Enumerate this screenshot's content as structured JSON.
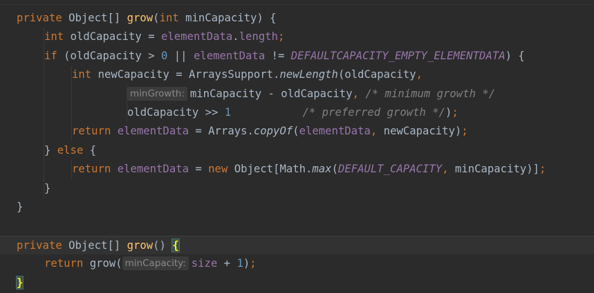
{
  "editor": {
    "lines": [
      {
        "indent": 0,
        "tokens": [
          {
            "t": "private ",
            "c": "kw"
          },
          {
            "t": "Object[] ",
            "c": "plain"
          },
          {
            "t": "grow",
            "c": "fn"
          },
          {
            "t": "(",
            "c": "plain"
          },
          {
            "t": "int ",
            "c": "kw"
          },
          {
            "t": "minCapacity) {",
            "c": "plain"
          }
        ]
      },
      {
        "indent": 1,
        "tokens": [
          {
            "t": "int ",
            "c": "kw"
          },
          {
            "t": "oldCapacity = ",
            "c": "plain"
          },
          {
            "t": "elementData",
            "c": "field"
          },
          {
            "t": ".",
            "c": "plain"
          },
          {
            "t": "length",
            "c": "field"
          },
          {
            "t": ";",
            "c": "kw"
          }
        ]
      },
      {
        "indent": 1,
        "tokens": [
          {
            "t": "if ",
            "c": "kw"
          },
          {
            "t": "(oldCapacity > ",
            "c": "plain"
          },
          {
            "t": "0",
            "c": "num"
          },
          {
            "t": " || ",
            "c": "plain"
          },
          {
            "t": "elementData",
            "c": "field"
          },
          {
            "t": " != ",
            "c": "plain"
          },
          {
            "t": "DEFAULTCAPACITY_EMPTY_ELEMENTDATA",
            "c": "const"
          },
          {
            "t": ") {",
            "c": "plain"
          }
        ]
      },
      {
        "indent": 2,
        "tokens": [
          {
            "t": "int ",
            "c": "kw"
          },
          {
            "t": "newCapacity = ArraysSupport.",
            "c": "plain"
          },
          {
            "t": "newLength",
            "c": "static"
          },
          {
            "t": "(oldCapacity",
            "c": "plain"
          },
          {
            "t": ",",
            "c": "kw"
          }
        ]
      },
      {
        "indent": 4,
        "hint": "minGrowth:",
        "tokens": [
          {
            "t": "minCapacity - oldCapacity",
            "c": "plain"
          },
          {
            "t": ", ",
            "c": "kw"
          },
          {
            "t": "/* minimum growth */",
            "c": "cmt"
          }
        ]
      },
      {
        "indent": 4,
        "tokens": [
          {
            "t": "oldCapacity >> ",
            "c": "plain"
          },
          {
            "t": "1",
            "c": "num"
          },
          {
            "t": "           ",
            "c": "plain"
          },
          {
            "t": "/* preferred growth */",
            "c": "cmt"
          },
          {
            "t": ")",
            "c": "plain"
          },
          {
            "t": ";",
            "c": "kw"
          }
        ]
      },
      {
        "indent": 2,
        "tokens": [
          {
            "t": "return ",
            "c": "kw"
          },
          {
            "t": "elementData",
            "c": "field"
          },
          {
            "t": " = Arrays.",
            "c": "plain"
          },
          {
            "t": "copyOf",
            "c": "static"
          },
          {
            "t": "(",
            "c": "plain"
          },
          {
            "t": "elementData",
            "c": "field"
          },
          {
            "t": ", ",
            "c": "kw"
          },
          {
            "t": "newCapacity)",
            "c": "plain"
          },
          {
            "t": ";",
            "c": "kw"
          }
        ]
      },
      {
        "indent": 1,
        "tokens": [
          {
            "t": "} ",
            "c": "plain"
          },
          {
            "t": "else ",
            "c": "kw"
          },
          {
            "t": "{",
            "c": "plain"
          }
        ]
      },
      {
        "indent": 2,
        "tokens": [
          {
            "t": "return ",
            "c": "kw"
          },
          {
            "t": "elementData",
            "c": "field"
          },
          {
            "t": " = ",
            "c": "plain"
          },
          {
            "t": "new ",
            "c": "kw"
          },
          {
            "t": "Object[Math.",
            "c": "plain"
          },
          {
            "t": "max",
            "c": "static"
          },
          {
            "t": "(",
            "c": "plain"
          },
          {
            "t": "DEFAULT_CAPACITY",
            "c": "const"
          },
          {
            "t": ", ",
            "c": "kw"
          },
          {
            "t": "minCapacity)]",
            "c": "plain"
          },
          {
            "t": ";",
            "c": "kw"
          }
        ]
      },
      {
        "indent": 1,
        "tokens": [
          {
            "t": "}",
            "c": "plain"
          }
        ]
      },
      {
        "indent": 0,
        "tokens": [
          {
            "t": "}",
            "c": "plain"
          }
        ]
      },
      {
        "indent": 0,
        "tokens": []
      },
      {
        "indent": 0,
        "current": true,
        "tokens": [
          {
            "t": "private ",
            "c": "kw"
          },
          {
            "t": "Object[] ",
            "c": "plain"
          },
          {
            "t": "grow",
            "c": "fn"
          },
          {
            "t": "() ",
            "c": "plain"
          },
          {
            "t": "{",
            "c": "match"
          }
        ]
      },
      {
        "indent": 1,
        "hint_after": "grow(",
        "tokens": [
          {
            "t": "return ",
            "c": "kw"
          },
          {
            "t": "grow(",
            "c": "plain"
          },
          {
            "t": "@HINT@",
            "c": "hint",
            "hint": "minCapacity:"
          },
          {
            "t": "size",
            "c": "field"
          },
          {
            "t": " + ",
            "c": "plain"
          },
          {
            "t": "1",
            "c": "num"
          },
          {
            "t": ")",
            "c": "plain"
          },
          {
            "t": ";",
            "c": "kw"
          }
        ]
      },
      {
        "indent": 0,
        "tokens": [
          {
            "t": "}",
            "c": "match"
          }
        ]
      }
    ]
  }
}
